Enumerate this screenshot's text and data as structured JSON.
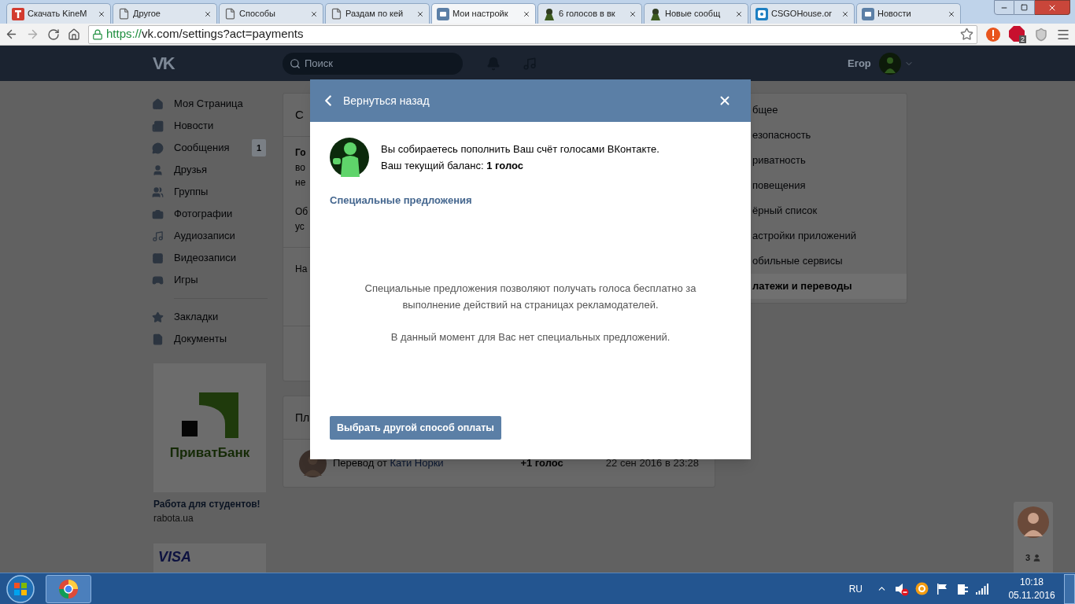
{
  "browser": {
    "tabs": [
      {
        "title": "Скачать KineM",
        "selected": false
      },
      {
        "title": "Другое",
        "selected": false
      },
      {
        "title": "Способы",
        "selected": false
      },
      {
        "title": "Раздам по кей",
        "selected": false
      },
      {
        "title": "Мои настройк",
        "selected": true
      },
      {
        "title": "6 голосов в вк",
        "selected": false
      },
      {
        "title": "Новые сообщ",
        "selected": false
      },
      {
        "title": "CSGOHouse.or",
        "selected": false
      },
      {
        "title": "Новости",
        "selected": false
      }
    ],
    "url_scheme": "https://",
    "url_rest": "vk.com/settings?act=payments",
    "adblock_count": "2"
  },
  "header": {
    "logo": "VK",
    "search_placeholder": "Поиск",
    "user_name": "Егор"
  },
  "sidebar": {
    "items": [
      {
        "label": "Моя Страница"
      },
      {
        "label": "Новости"
      },
      {
        "label": "Сообщения",
        "badge": "1"
      },
      {
        "label": "Друзья"
      },
      {
        "label": "Группы"
      },
      {
        "label": "Фотографии"
      },
      {
        "label": "Аудиозаписи"
      },
      {
        "label": "Видеозаписи"
      },
      {
        "label": "Игры"
      }
    ],
    "secondary": [
      {
        "label": "Закладки"
      },
      {
        "label": "Документы"
      }
    ]
  },
  "ads": [
    {
      "logo_text": "ПриватБанк",
      "title": "Работа для студентов!",
      "site": "rabota.ua"
    },
    {
      "logo_text": "VISA"
    }
  ],
  "main": {
    "card_title": "С",
    "lines": [
      {
        "text": "Го",
        "bold": true
      },
      {
        "text": "во",
        "bold": false
      },
      {
        "text": "не",
        "bold": false
      },
      {
        "text": "Об",
        "bold": false
      },
      {
        "text": "ус",
        "bold": false
      }
    ],
    "row_text": "На",
    "payments_title": "Пл",
    "payment": {
      "prefix": "Перевод от",
      "name": "Кати Норки",
      "amount": "+1 голос",
      "date": "22 сен 2016 в 23:28"
    }
  },
  "settings_menu": [
    {
      "label": "бщее",
      "selected": false
    },
    {
      "label": "езопасность",
      "selected": false
    },
    {
      "label": "риватность",
      "selected": false
    },
    {
      "label": "повещения",
      "selected": false
    },
    {
      "label": "ёрный список",
      "selected": false
    },
    {
      "label": "астройки приложений",
      "selected": false
    },
    {
      "label": "обильные сервисы",
      "selected": false
    },
    {
      "label": "латежи и переводы",
      "selected": true
    }
  ],
  "modal": {
    "title": "Вернуться назад",
    "intro": "Вы собираетесь пополнить Ваш счёт голосами ВКонтакте.",
    "balance": "Ваш текущий баланс: **1 голос**",
    "section_title": "Специальные предложения",
    "description": "Специальные предложения позволяют получать голоса бесплатно за выполнение действий на страницах рекламодателей.",
    "empty_note": "В данный момент для Вас нет специальных предложений.",
    "button": "Выбрать другой способ оплаты"
  },
  "chat": {
    "count": "3"
  },
  "taskbar": {
    "language": "RU",
    "time": "10:18",
    "date": "05.11.2016"
  }
}
